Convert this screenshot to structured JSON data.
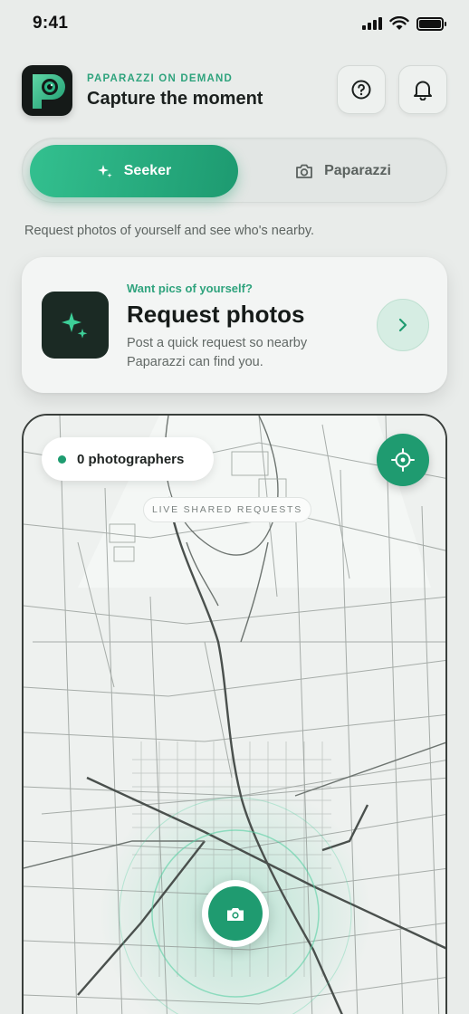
{
  "status_bar": {
    "time": "9:41"
  },
  "header": {
    "eyebrow": "PAPARAZZI ON DEMAND",
    "title": "Capture the moment",
    "logo_letter": "P",
    "help_icon": "question-circle-icon",
    "bell_icon": "bell-icon"
  },
  "mode_toggle": {
    "seeker_label": "Seeker",
    "seeker_icon": "sparkle-icon",
    "paparazzi_label": "Paparazzi",
    "paparazzi_icon": "camera-icon",
    "selected": "Seeker"
  },
  "subtitle": "Request photos of yourself and see who's nearby.",
  "request_card": {
    "eyebrow": "Want pics of yourself?",
    "title": "Request photos",
    "description": "Post a quick request so nearby Paparazzi can find you.",
    "icon": "sparkle-icon",
    "arrow_icon": "chevron-right-icon"
  },
  "map": {
    "photographers_label": "0 photographers",
    "live_label": "LIVE SHARED REQUESTS",
    "locate_icon": "crosshair-icon",
    "camera_icon": "camera-icon"
  },
  "colors": {
    "accent": "#1f9b70",
    "accent_light": "#33c08f",
    "background": "#e9ecea",
    "logo_bg": "#151a18"
  }
}
